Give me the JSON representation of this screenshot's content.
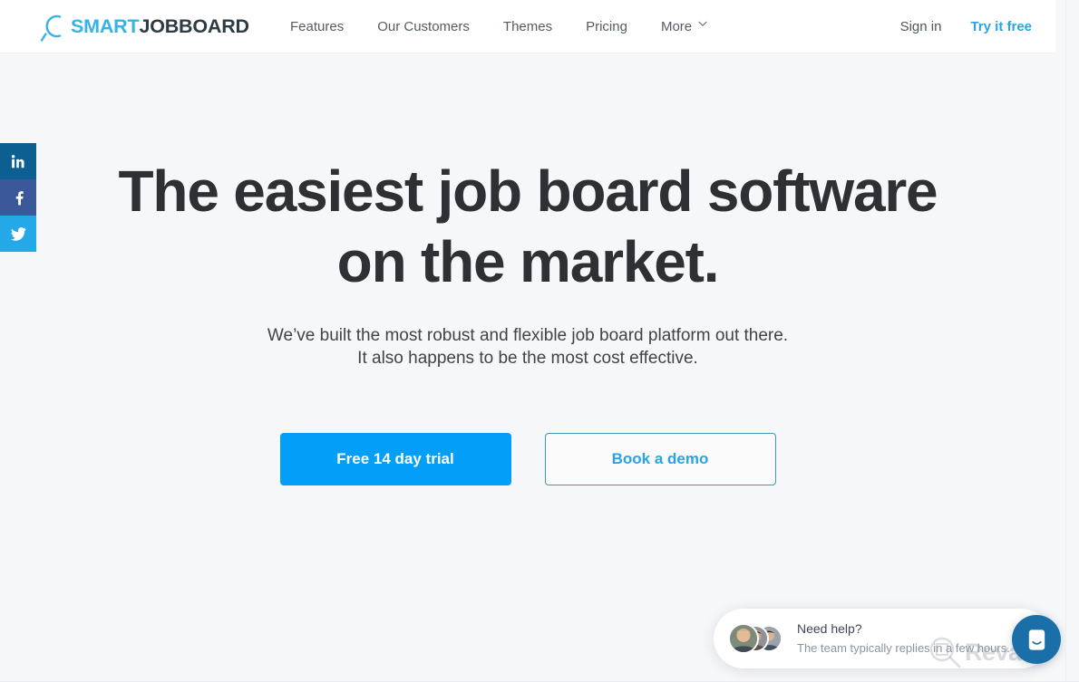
{
  "brand": {
    "logo_smart": "SMART",
    "logo_jobboard": "JOBBOARD",
    "logo_icon": "magnifier-icon",
    "accent_blue": "#039ef7",
    "logo_light_blue": "#35b3e8",
    "logo_dark": "#2f3b44"
  },
  "header": {
    "nav": [
      {
        "label": "Features",
        "icon": ""
      },
      {
        "label": "Our Customers",
        "icon": ""
      },
      {
        "label": "Themes",
        "icon": ""
      },
      {
        "label": "Pricing",
        "icon": ""
      },
      {
        "label": "More",
        "icon": "chevron-down-icon"
      }
    ],
    "sign_in": "Sign in",
    "try_it_free": "Try it free"
  },
  "social_rail": [
    {
      "name": "linkedin",
      "icon": "linkedin-icon",
      "label": "in",
      "color": "#0d5f92"
    },
    {
      "name": "facebook",
      "icon": "facebook-icon",
      "label": "f",
      "color": "#3b5998"
    },
    {
      "name": "twitter",
      "icon": "twitter-icon",
      "label": "twitter",
      "color": "#25a8e8"
    }
  ],
  "hero": {
    "title_line1": "The easiest job board software",
    "title_line2": "on the market.",
    "subtitle_line1": "We’ve built the most robust and flexible job board platform out there.",
    "subtitle_line2": "It also happens to be the most cost effective.",
    "primary_cta": "Free 14 day trial",
    "secondary_cta": "Book a demo"
  },
  "chat": {
    "title": "Need help?",
    "subtitle": "The team typically replies in a few hours.",
    "launcher_icon": "intercom-face-icon",
    "launcher_color": "#1b6fa8",
    "avatar_count": 3
  },
  "watermark": {
    "text": "Revain",
    "icon": "revain-magnifier-icon"
  }
}
